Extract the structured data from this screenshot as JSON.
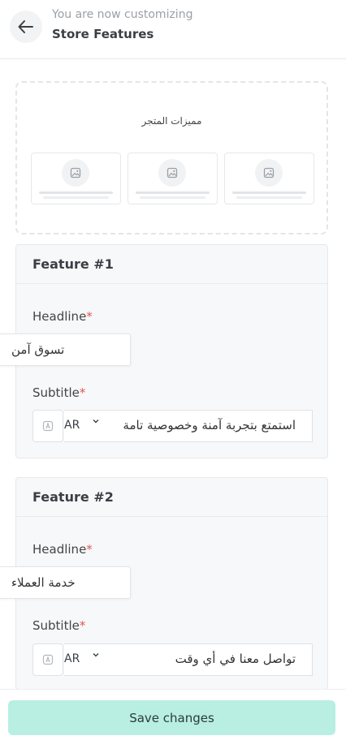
{
  "header": {
    "subtitle": "You are now customizing",
    "title": "Store Features"
  },
  "preview": {
    "title": "مميزات المتجر",
    "cards": [
      {
        "icon": "image-icon"
      },
      {
        "icon": "image-icon"
      },
      {
        "icon": "image-icon"
      }
    ]
  },
  "features": [
    {
      "title": "Feature #1",
      "headline_label": "Headline",
      "headline_value": "تسوق آمن",
      "subtitle_label": "Subtitle",
      "subtitle_lang": "AR",
      "subtitle_value": "استمتع بتجربة آمنة وخصوصية تامة"
    },
    {
      "title": "Feature #2",
      "headline_label": "Headline",
      "headline_value": "خدمة العملاء",
      "subtitle_label": "Subtitle",
      "subtitle_lang": "AR",
      "subtitle_value": "تواصل معنا في أي وقت"
    }
  ],
  "required_mark": "*",
  "footer": {
    "save_label": "Save changes"
  },
  "colors": {
    "accent": "#b8efe2",
    "required": "#e35656",
    "border": "#e6e8ea"
  }
}
